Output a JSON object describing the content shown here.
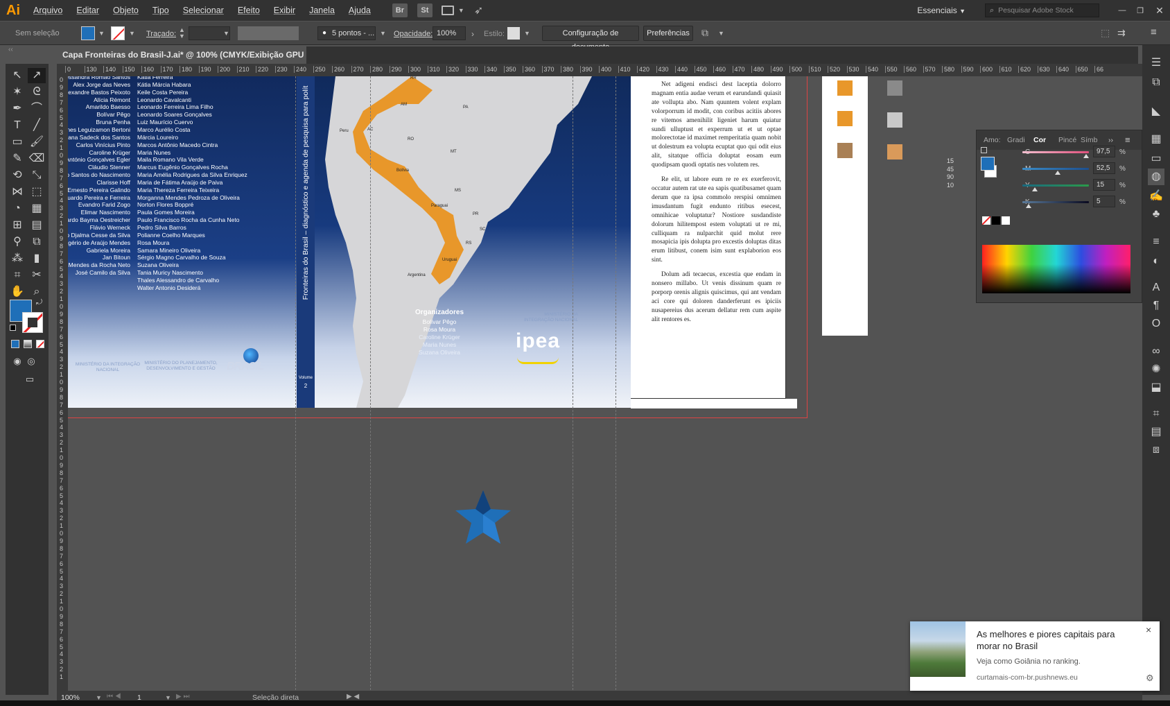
{
  "app": {
    "logo": "Ai"
  },
  "menu": [
    "Arquivo",
    "Editar",
    "Objeto",
    "Tipo",
    "Selecionar",
    "Efeito",
    "Exibir",
    "Janela",
    "Ajuda"
  ],
  "menu_buttons": [
    "Br",
    "St"
  ],
  "workspace": "Essenciais",
  "stock_search_placeholder": "Pesquisar Adobe Stock",
  "control_bar": {
    "selection": "Sem seleção",
    "stroke_label": "Traçado:",
    "brush": "5 pontos - ...",
    "opacity_label": "Opacidade:",
    "opacity_value": "100%",
    "style_label": "Estilo:",
    "doc_setup": "Configuração de documento",
    "preferences": "Preferências"
  },
  "document_tab": {
    "title": "Capa Fronteiras do Brasil-J.ai* @ 100% (CMYK/Exibição GPU )",
    "close": "×"
  },
  "ruler": {
    "h": [
      "0",
      "130",
      "140",
      "150",
      "160",
      "170",
      "180",
      "190",
      "200",
      "210",
      "220",
      "230",
      "240",
      "250",
      "260",
      "270",
      "280",
      "290",
      "300",
      "310",
      "320",
      "330",
      "340",
      "350",
      "360",
      "370",
      "380",
      "390",
      "400",
      "410",
      "420",
      "430",
      "440",
      "450",
      "460",
      "470",
      "480",
      "490",
      "500",
      "510",
      "520",
      "530",
      "540",
      "550",
      "560",
      "570",
      "580",
      "590",
      "600",
      "610",
      "620",
      "630",
      "640",
      "650",
      "66"
    ],
    "v": [
      "0",
      "9",
      "8",
      "7",
      "6",
      "5",
      "4",
      "3",
      "2",
      "1",
      "0",
      "9",
      "8",
      "7",
      "6",
      "5",
      "4",
      "3",
      "2",
      "1",
      "0",
      "9",
      "8",
      "7",
      "6",
      "5",
      "4",
      "3",
      "2",
      "1",
      "0",
      "9",
      "8",
      "7",
      "6",
      "5",
      "4",
      "3",
      "2",
      "1",
      "0",
      "9",
      "8",
      "7",
      "6",
      "5",
      "4",
      "3",
      "2",
      "1",
      "0",
      "9",
      "8",
      "7",
      "6",
      "5",
      "4",
      "3",
      "2",
      "1",
      "0",
      "9",
      "8",
      "7",
      "6",
      "5",
      "4",
      "3",
      "2",
      "1",
      "0",
      "9",
      "8",
      "7",
      "6",
      "5",
      "4",
      "3",
      "2",
      "1"
    ]
  },
  "cover": {
    "names_left": [
      "Jessandra Romão Santos",
      "Alex Jorge das Neves",
      "Alexandre Bastos Peixoto",
      "Alícia Rémont",
      "Amarildo Baesso",
      "Bolívar Pêgo",
      "Bruna Penha",
      "nes Leguizamon Bertoni",
      "Viana Sadeck dos Santos",
      "Carlos Vinícius Pinto",
      "Caroline Krüger",
      "António Gonçalves Egler",
      "Cláudio Stenner",
      "o Santos do Nascimento",
      "Clarisse Hoff",
      "Ernesto Pereira Galindo",
      "duardo Pereira e Ferreira",
      "Evandro Farid Zogo",
      "Elimar Nascimento",
      "ardo Bayma Oestreicher",
      "Flávio Werneck",
      "co Djalma Cesse da Silva",
      "gério de Araújo Mendes",
      "Gabriela Moreira",
      "Jan Bitoun",
      "o Mendes da Rocha Neto",
      "José Camilo da Silva"
    ],
    "names_right": [
      "Kátia Ferreira",
      "Kátia Márcia Habara",
      "Keile Costa Pereira",
      "Leonardo Cavalcanti",
      "Leonardo Ferreira Lima Filho",
      "Leonardo Soares Gonçalves",
      "Luiz Maurício Cuervo",
      "Marco Aurélio Costa",
      "Márcia Loureiro",
      "Marcos Antônio Macedo Cintra",
      "Maria Nunes",
      "Maila Romano Vila Verde",
      "Marcus Eugênio Gonçalves Rocha",
      "Maria Amélia Rodrigues da Silva Enriquez",
      "Maria de Fátima Araújo de Paiva",
      "Maria Thereza Ferreira Teixeira",
      "Morganna Mendes Pedroza de Oliveira",
      "Norton Flores Boppré",
      "Paula Gomes Moreira",
      "Paulo Francisco Rocha da Cunha Neto",
      "Pedro Silva Barros",
      "Polianne Coelho Marques",
      "Rosa Moura",
      "Samara Mineiro Oliveira",
      "Sérgio Magno Carvalho de Souza",
      "Suzana Oliveira",
      "Tania Muricy Nascimento",
      "Thales Alessandro de Carvalho",
      "Walter Antonio Desiderá"
    ],
    "back_logos": [
      "MINISTÉRIO DA INTEGRAÇÃO NACIONAL",
      "MINISTÉRIO DO PLANEJAMENTO, DESENVOLVIMENTO E GESTÃO",
      "BRASIL"
    ],
    "spine_title": "Fronteiras do Brasil – diagnóstico e agenda de pesquisa para polít",
    "spine_volume": "Volume",
    "spine_number": "2",
    "map_labels": [
      "RR",
      "AM",
      "PA",
      "AC",
      "Peru",
      "RO",
      "MT",
      "Bolívia",
      "MS",
      "Paraguai",
      "PR",
      "SC",
      "RS",
      "Uruguai",
      "Argentina"
    ],
    "organizers_title": "Organizadores",
    "organizers": [
      "Bolívar Pêgo",
      "Rosa Moura",
      "Caroline Krüger",
      "Maria Nunes",
      "Suzana Oliveira"
    ],
    "ministry": "MINISTÉRIO DA INTEGRAÇÃO NACIONAL",
    "ipea": "ipea",
    "flap_paragraphs": [
      "Net adigeni endisci dest laceptia dolorro magnam entia audae verum et earundandi quiasit ate vollupta abo. Nam quuntem volent explam volorporrum id modit, con coribus acitiis abores re vitemos amenihilit ligeniet harum quiatur sundi ulluptust et experrum ut et ut optae molorectotae id maximet remperitatia quam nobit ut dolestrum ea volupta ecuptat quo qui odit eius alit, sitatque officia doluptat eosam eum quodipsam quodi optatis nes volutem res.",
      "Re elit, ut labore eum re re ex exerferovit, occatur autem rat ute ea sapis quatibusamet quam derum que ra ipsa commolo rerspisi omnimen imusdantum fugit endunto ritibus esecest, omnihicae voluptatur? Nostiore susdandiste dolorum hilitempost estem voluptati ut re mi, culliquam ra nulparchit quid molut rere mosapicia ipis dolupta pro excestis doluptas ditas erum litibust, conem isim sunt explaborion eos sint.",
      "Dolum adi tecaecus, excestia que endam in nonsero millabo. Ut venis dissinum quam re porporp orenis alignis quiscimus, qui ant vendam aci core qui doloren danderferunt es ipiciis nusapereius dus acerum dellatur rem cum aspite alit rentores es."
    ]
  },
  "annotation_numbers": [
    "15",
    "45",
    "90",
    "10"
  ],
  "color_panel": {
    "tabs": [
      "Amo:",
      "Gradi",
      "Cor",
      "Pincé",
      "Símb"
    ],
    "sliders": [
      {
        "label": "C",
        "value": "97,5",
        "fraction": 0.975
      },
      {
        "label": "M",
        "value": "52,5",
        "fraction": 0.525
      },
      {
        "label": "Y",
        "value": "15",
        "fraction": 0.15
      },
      {
        "label": "K",
        "value": "5",
        "fraction": 0.05
      }
    ],
    "pct": "%"
  },
  "status": {
    "zoom": "100%",
    "artboard": "1",
    "tool": "Seleção direta"
  },
  "notification": {
    "title": "As melhores e piores capitais para morar no Brasil",
    "body": "Veja como Goiânia no ranking.",
    "source": "curtamais-com-br.pushnews.eu",
    "close": "×"
  },
  "colors": {
    "accent_blue": "#1f6fb8",
    "orange": "#e8972a",
    "brown": "#a98055",
    "tan": "#d99a5a"
  }
}
